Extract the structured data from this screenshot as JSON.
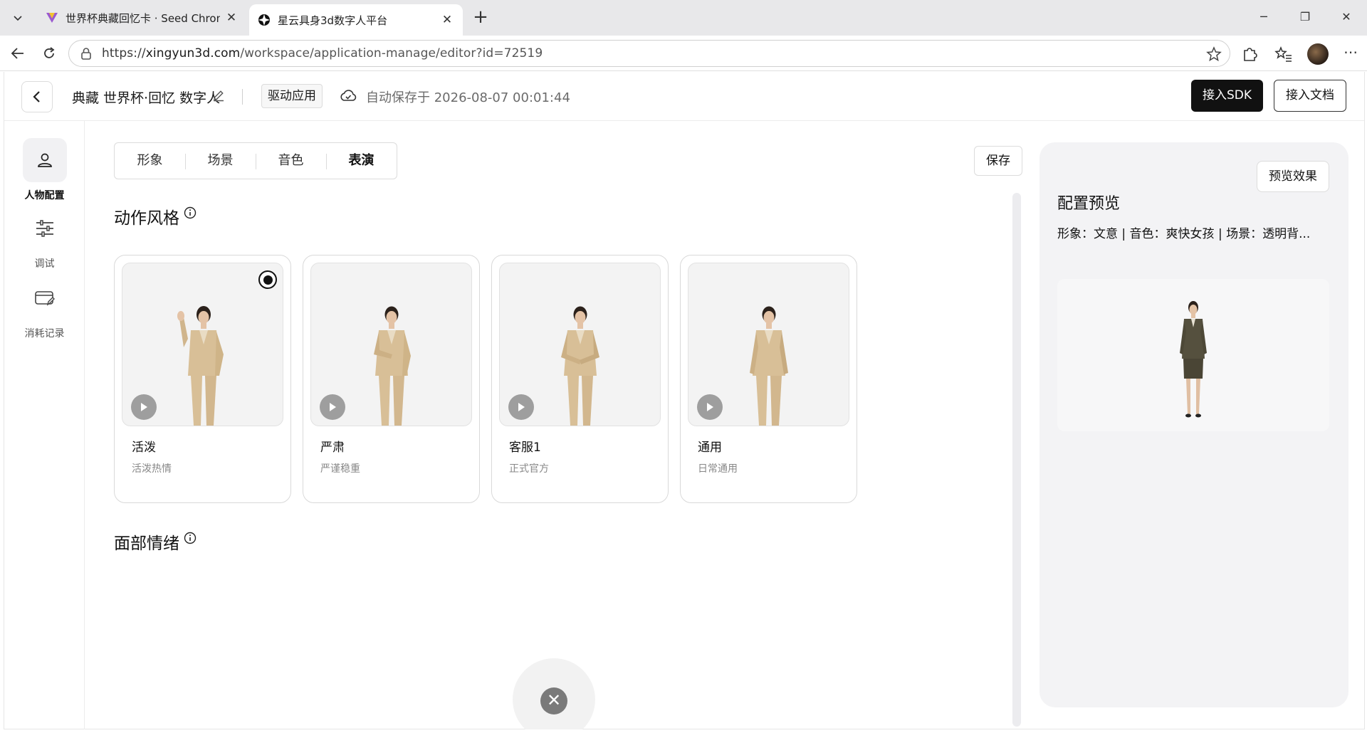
{
  "browser": {
    "tabs": [
      {
        "title": "世界杯典藏回忆卡 · Seed Chronicle",
        "active": false
      },
      {
        "title": "星云具身3d数字人平台",
        "active": true
      }
    ],
    "url_scheme": "https://",
    "url_host": "xingyun3d.com",
    "url_path": "/workspace/application-manage/editor?id=72519"
  },
  "header": {
    "app_title": "典藏 世界杯·回忆 数字人",
    "tag": "驱动应用",
    "autosave": "自动保存于 2026-08-07 00:01:44",
    "sdk_button": "接入SDK",
    "doc_button": "接入文档"
  },
  "sidenav": {
    "items": [
      {
        "label": "人物配置",
        "icon": "person-icon",
        "active": true
      },
      {
        "label": "调试",
        "icon": "sliders-icon",
        "active": false
      },
      {
        "label": "消耗记录",
        "icon": "card-edit-icon",
        "active": false
      }
    ]
  },
  "tabs": [
    {
      "label": "形象",
      "active": false
    },
    {
      "label": "场景",
      "active": false
    },
    {
      "label": "音色",
      "active": false
    },
    {
      "label": "表演",
      "active": true
    }
  ],
  "save_button": "保存",
  "sections": {
    "motion_style": "动作风格",
    "facial_emotion": "面部情绪"
  },
  "motion_styles": [
    {
      "name": "活泼",
      "desc": "活泼热情",
      "selected": true
    },
    {
      "name": "严肃",
      "desc": "严谨稳重",
      "selected": false
    },
    {
      "name": "客服1",
      "desc": "正式官方",
      "selected": false
    },
    {
      "name": "通用",
      "desc": "日常通用",
      "selected": false
    }
  ],
  "preview": {
    "button": "预览效果",
    "title": "配置预览",
    "summary": "形象：文意 | 音色：爽快女孩 | 场景：透明背..."
  },
  "colors": {
    "accent": "#111111",
    "suit": "#d8bf97",
    "preview_dress": "#55503e"
  }
}
